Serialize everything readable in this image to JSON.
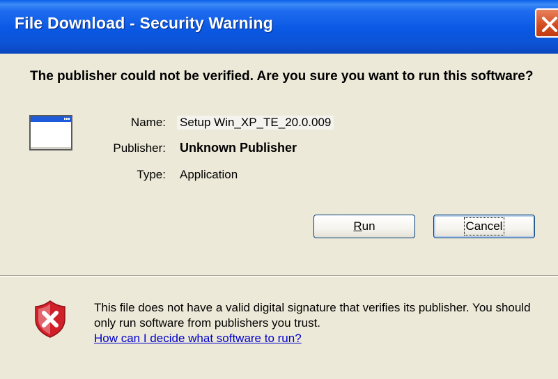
{
  "window": {
    "title": "File Download - Security Warning"
  },
  "heading": "The publisher could not be verified.  Are you sure you want to run this software?",
  "details": {
    "name_label": "Name:",
    "name_value": "Setup Win_XP_TE_20.0.009",
    "publisher_label": "Publisher:",
    "publisher_value": "Unknown Publisher",
    "type_label": "Type:",
    "type_value": "Application"
  },
  "buttons": {
    "run_label_accel": "R",
    "run_label_rest": "un",
    "cancel_label": "Cancel"
  },
  "warning": {
    "text": "This file does not have a valid digital signature that verifies its publisher.  You should only run software from publishers you trust.",
    "link": "How can I decide what software to run?"
  },
  "icons": {
    "close": "close-icon",
    "application": "application-window-icon",
    "warning": "security-shield-x-icon"
  },
  "colors": {
    "titlebar": "#0A58E3",
    "dialog_bg": "#ECE9D8",
    "close_button": "#D24A1F",
    "link": "#0000CC",
    "shield_red": "#D0202A"
  }
}
